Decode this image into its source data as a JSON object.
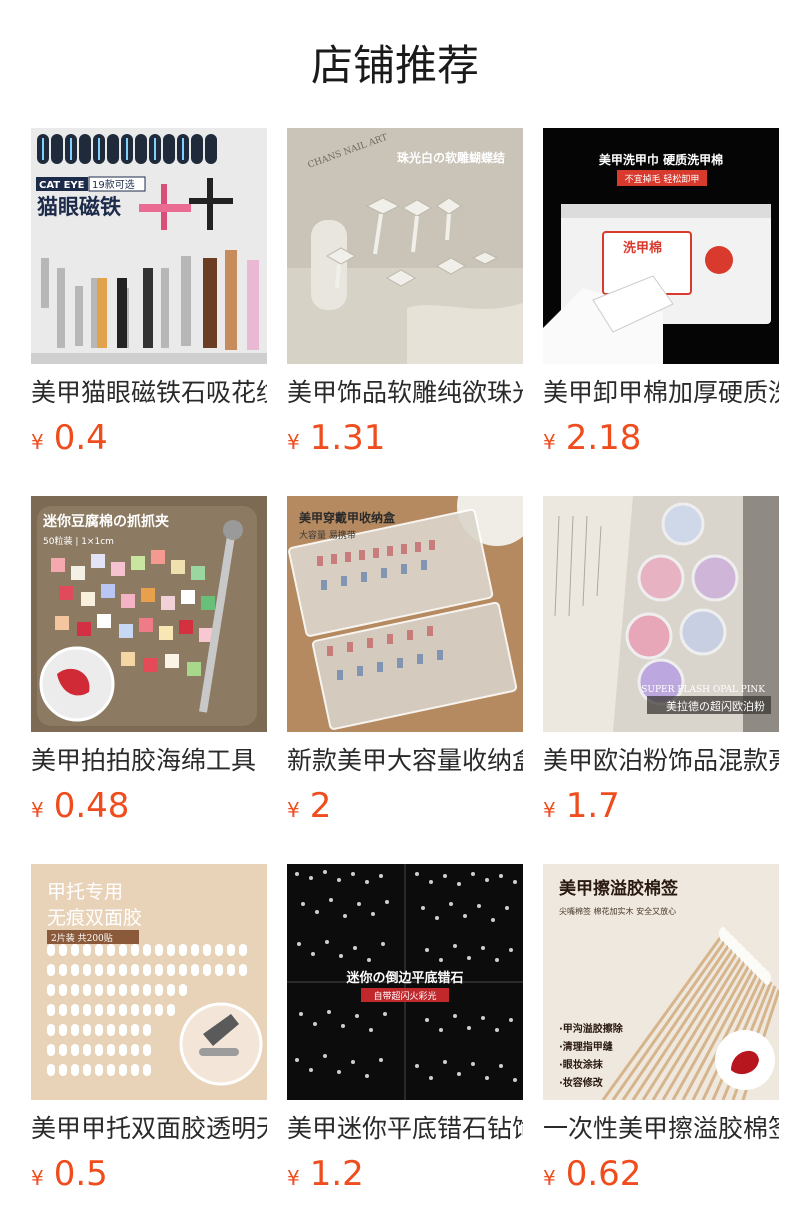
{
  "section": {
    "title": "店铺推荐"
  },
  "products": [
    {
      "name": "美甲猫眼磁铁石吸花纹",
      "price": "0.4",
      "image": {
        "text": [
          "CAT EYE",
          "19款可选",
          "猫眼磁铁"
        ]
      }
    },
    {
      "name": "美甲饰品软雕纯欲珠光白",
      "price": "1.31",
      "image": {
        "text": [
          "珠光白の软雕蝴蝶结",
          "CHANS NAIL ART"
        ]
      }
    },
    {
      "name": "美甲卸甲棉加厚硬质洗甲",
      "price": "2.18",
      "image": {
        "text": [
          "美甲洗甲巾 硬质洗甲棉",
          "不宜掉毛 轻松卸甲",
          "洗甲棉"
        ]
      }
    },
    {
      "name": "美甲拍拍胶海绵工具",
      "price": "0.48",
      "image": {
        "text": [
          "迷你豆腐棉の抓抓夹",
          "50粒装 | 1×1cm"
        ]
      }
    },
    {
      "name": "新款美甲大容量收纳盒",
      "price": "2",
      "image": {
        "text": [
          "美甲穿戴甲收纳盒",
          "大容量 易携带"
        ]
      }
    },
    {
      "name": "美甲欧泊粉饰品混款亮片",
      "price": "1.7",
      "image": {
        "text": [
          "SUPER FLASH OPAL PINK",
          "美拉德の超闪欧泊粉"
        ]
      }
    },
    {
      "name": "美甲甲托双面胶透明无痕",
      "price": "0.5",
      "image": {
        "text": [
          "甲托专用",
          "无痕双面胶",
          "2片装 共200贴"
        ]
      }
    },
    {
      "name": "美甲迷你平底错石钻饰",
      "price": "1.2",
      "image": {
        "text": [
          "迷你の倒边平底错石",
          "自带超闪火彩光"
        ]
      }
    },
    {
      "name": "一次性美甲擦溢胶棉签",
      "price": "0.62",
      "image": {
        "text": [
          "美甲擦溢胶棉签",
          "尖嘴棉签 棉花加实木 安全又放心",
          "·甲沟溢胶擦除",
          "·清理指甲缝",
          "·眼妆涂抹",
          "·妆容修改"
        ]
      }
    }
  ],
  "currency": "¥",
  "colors": {
    "price": "#ef4d1e",
    "title": "#1a1a1a",
    "name": "#2a2a2a"
  }
}
